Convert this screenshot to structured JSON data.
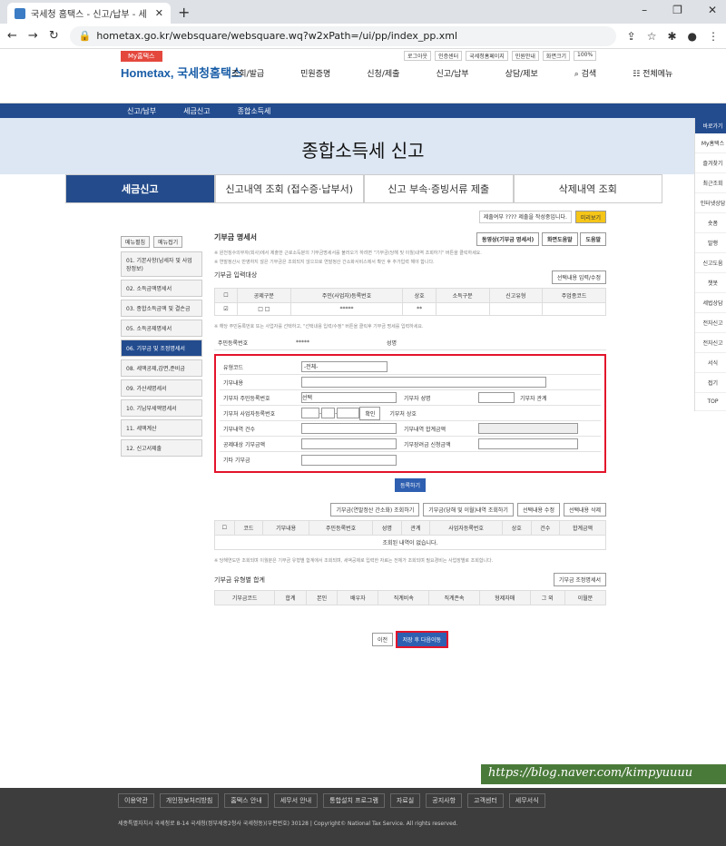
{
  "browser": {
    "tab_title": "국세청 홈택스 - 신고/납부 - 세",
    "url": "hometax.go.kr/websquare/websquare.wq?w2xPath=/ui/pp/index_pp.xml"
  },
  "site": {
    "my_hometax": "My홈택스",
    "logo": "Hometax, 국세청홈택스",
    "nav": [
      "조회/발급",
      "민원증명",
      "신청/제출",
      "신고/납부",
      "상담/제보"
    ],
    "search": "검색",
    "menu": "전체메뉴",
    "util": [
      "로그아웃",
      "인증센터",
      "국세청홈페이지",
      "민원안내",
      "화면크기",
      "100%"
    ],
    "breadcrumb": [
      "신고/납부",
      "세금신고",
      "종합소득세"
    ]
  },
  "page": {
    "title": "종합소득세 신고",
    "tabs": [
      "세금신고",
      "신고내역 조회 (접수증·납부서)",
      "신고 부속·증빙서류 제출",
      "삭제내역 조회"
    ]
  },
  "sidebar": {
    "btns": [
      "메뉴펼침",
      "메뉴접기"
    ],
    "items": [
      "01. 기본사항(납세자 및 사업장정보)",
      "02. 소득금액명세서",
      "03. 종합소득금액 및 결손금",
      "05. 소득공제명세서",
      "06. 기부금 및 조정명세서",
      "08. 세액공제,감면,준비금",
      "09. 가산세명세서",
      "10. 기납부세액명세서",
      "11. 세액계산",
      "12. 신고서제출"
    ]
  },
  "content": {
    "status": "제출여부 ???? 제출을 작성중입니다.",
    "preview": "미리보기",
    "section": "기부금 명세서",
    "head_btns": [
      "동영상(기부금 명세서)",
      "화면도움말",
      "도움말"
    ],
    "note1": "※ 원천징수의무자(회사)에서 제출한 근로소득분의 기부금명세서를 불러오기 하려면 \"기부금(당해 및 이월)내역 조회하기\" 버튼을 클릭하세요.",
    "note2": "※ 연말정산시 반영하지 않은 기부금은 조회되지 않으므로 연말정산 간소화서비스에서 확인 후 추가입력 해야 합니다.",
    "input_title": "기부금 입력대상",
    "select_btn": "선택내용 입력/수정",
    "grid_head": [
      "공제구분",
      "세액(소득)",
      "필요경비",
      "주민(사업자)등록번호",
      "상호",
      "소득구분",
      "신고유형",
      "주업종코드"
    ],
    "note3": "※ 해당 주민등록번호 또는 사업자를 선택하고, \"선택내용 입력/수정\" 버튼을 클릭후 기부금 명세를 입력하세요.",
    "idno": "주민등록번호",
    "name": "성명"
  },
  "form": {
    "type_code": "유형코드",
    "type_val": "-전체-",
    "content": "기부내용",
    "donee_id": "기부자 주민등록번호",
    "donee_sel": "선택",
    "donee_name": "기부자 성명",
    "relation": "기부자 관계",
    "biz_no": "기부처 사업자등록번호",
    "confirm": "확인",
    "biz_name": "기부처 상호",
    "count": "기부내역 건수",
    "sum": "기부내역 합계금액",
    "deduct": "공제대상 기부금액",
    "incentive": "기부장려금 신청금액",
    "etc": "기타 기부금",
    "register": "등록하기"
  },
  "lower": {
    "btn1": "기부금(연말정산 간소화) 조회하기",
    "btn2": "기부금(당해 및 이월)내역 조회하기",
    "btn3": "선택내용 수정",
    "btn4": "선택내용 삭제",
    "cols": [
      "코드",
      "기부내용",
      "주민등록번호",
      "성명",
      "관계",
      "사업자등록번호",
      "상호",
      "건수",
      "합계금액"
    ],
    "empty": "조회된 내역이 없습니다.",
    "note": "※ 당해연도만 조회되며 이월분은 기부금 유형별 합계에서 조회되며, 세액공제로 입력한 자료는 전체가 조회되며 필요경비는 사업장별로 조회합니다.",
    "sum_title": "기부금 유형별 합계",
    "sum_btn": "기부금 조정명세서",
    "sum_cols": [
      "기부금코드",
      "당해연도",
      "기부자 구분",
      "합계",
      "본인",
      "배우자",
      "직계비속",
      "직계존속",
      "형제자매",
      "그 외",
      "이월분"
    ],
    "prev": "이전",
    "next": "저장 후 다음이동"
  },
  "rightbar": {
    "title": "바로가기",
    "items": [
      "My홈택스",
      "즐겨찾기",
      "최근조회",
      "인터넷상담",
      "숏폼",
      "발행",
      "신고도움",
      "챗봇",
      "세법상담",
      "전자신고",
      "전자신고",
      "서식",
      "접기",
      "TOP"
    ]
  },
  "watermark": "https://blog.naver.com/kimpyuuuu",
  "footer": {
    "links": [
      "이용약관",
      "개인정보처리방침",
      "홈택스 안내",
      "세무서 안내",
      "통합설치 프로그램",
      "자료실",
      "공지사항",
      "고객센터",
      "세무서식"
    ],
    "copy": "세종특별자치시 국세청로 8-14 국세청(정부세종2청사 국세청동)(우편번호) 30128 | Copyright© National Tax Service. All rights reserved."
  }
}
